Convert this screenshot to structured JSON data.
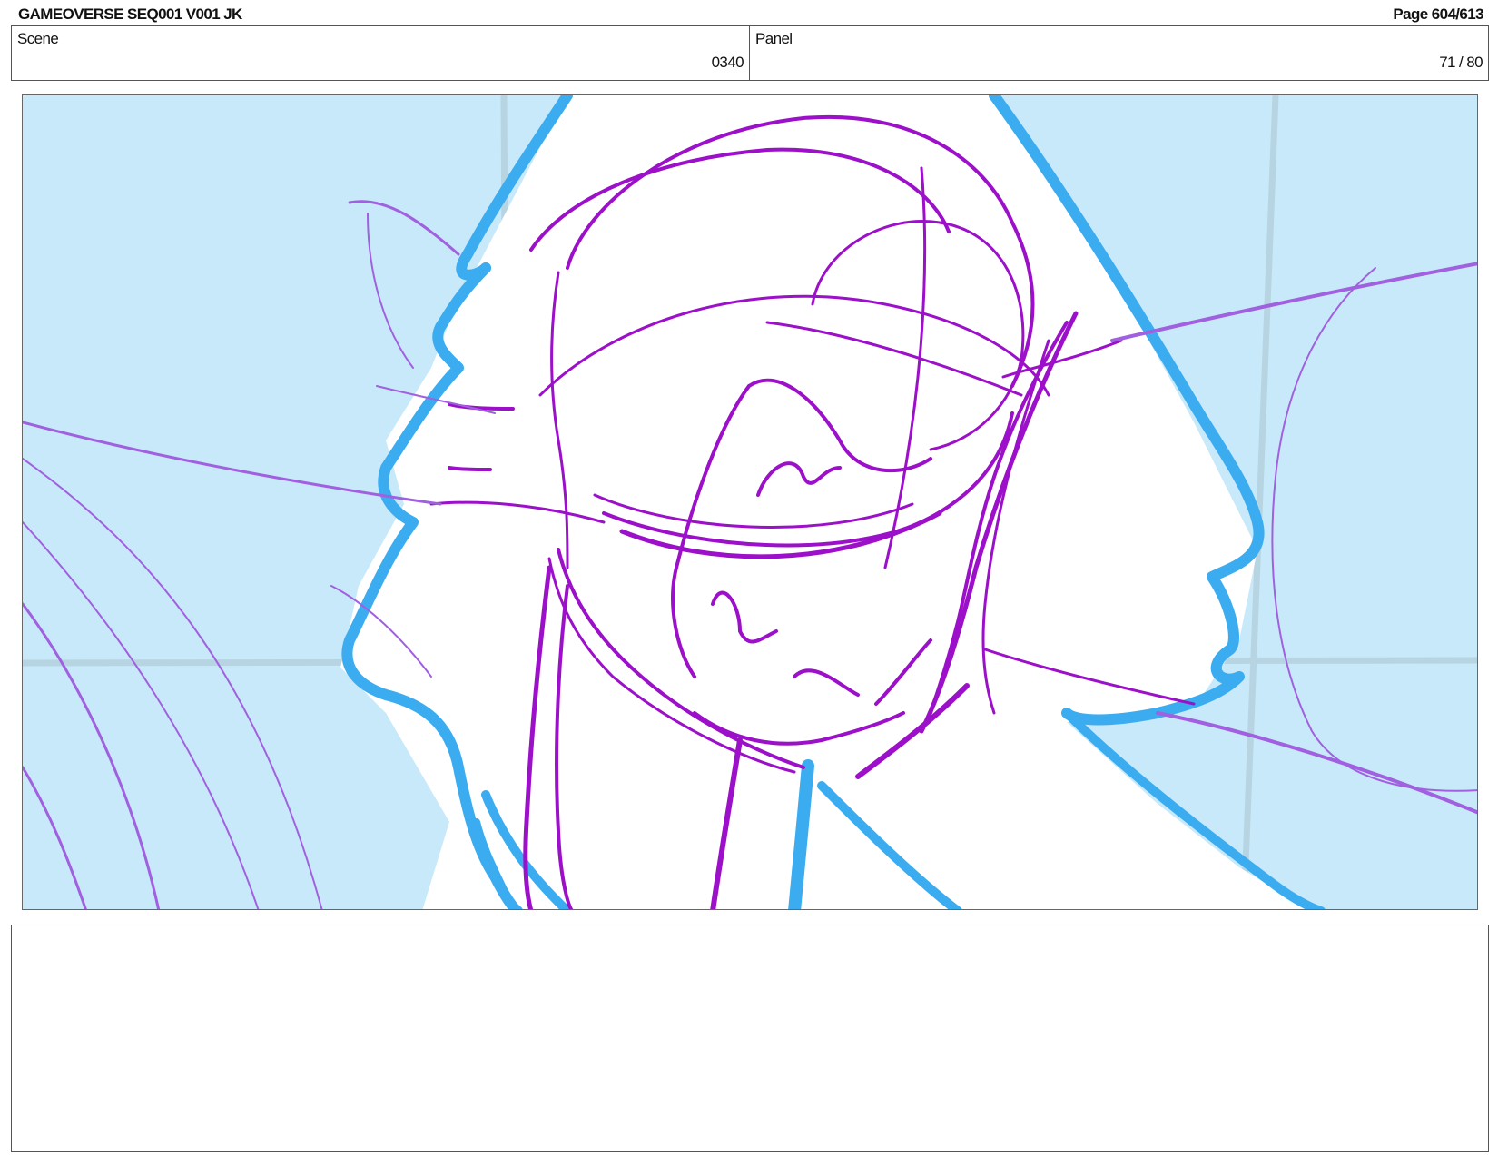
{
  "header": {
    "project": "GAMEOVERSE SEQ001 V001 JK",
    "page": "Page 604/613"
  },
  "info": {
    "scene_label": "Scene",
    "scene_value": "0340",
    "panel_label": "Panel",
    "panel_value": "71 / 80"
  },
  "colors": {
    "background": "#c8e9f9",
    "sketch": "#9b10c8",
    "sketch_light": "#a060e0",
    "outline": "#3aacef",
    "grid": "#b7d4e2"
  },
  "notes": {
    "text": ""
  }
}
